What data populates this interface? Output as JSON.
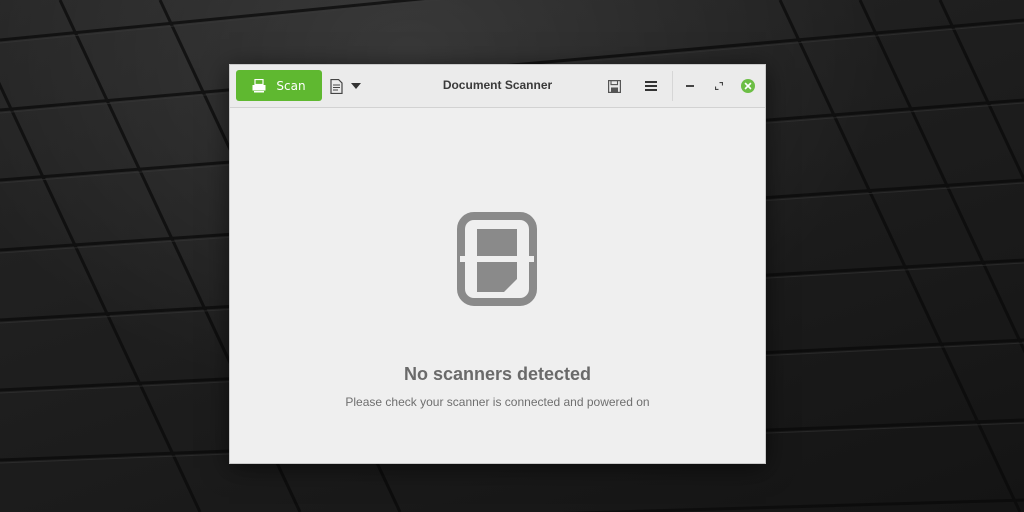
{
  "window": {
    "title": "Document Scanner"
  },
  "toolbar": {
    "scan_label": "Scan",
    "scan_icon": "scanner-icon",
    "document_type_icon": "document-icon",
    "dropdown_icon": "chevron-down-icon",
    "save_icon": "save-icon",
    "menu_icon": "hamburger-menu-icon"
  },
  "window_controls": {
    "minimize_icon": "minimize-icon",
    "maximize_icon": "maximize-icon",
    "close_icon": "close-icon"
  },
  "status": {
    "title": "No scanners detected",
    "message": "Please check your scanner is connected and powered on"
  },
  "colors": {
    "accent": "#5fb830",
    "close": "#6cbe45",
    "empty_icon": "#8a8a8a",
    "window_bg": "#efefef"
  }
}
